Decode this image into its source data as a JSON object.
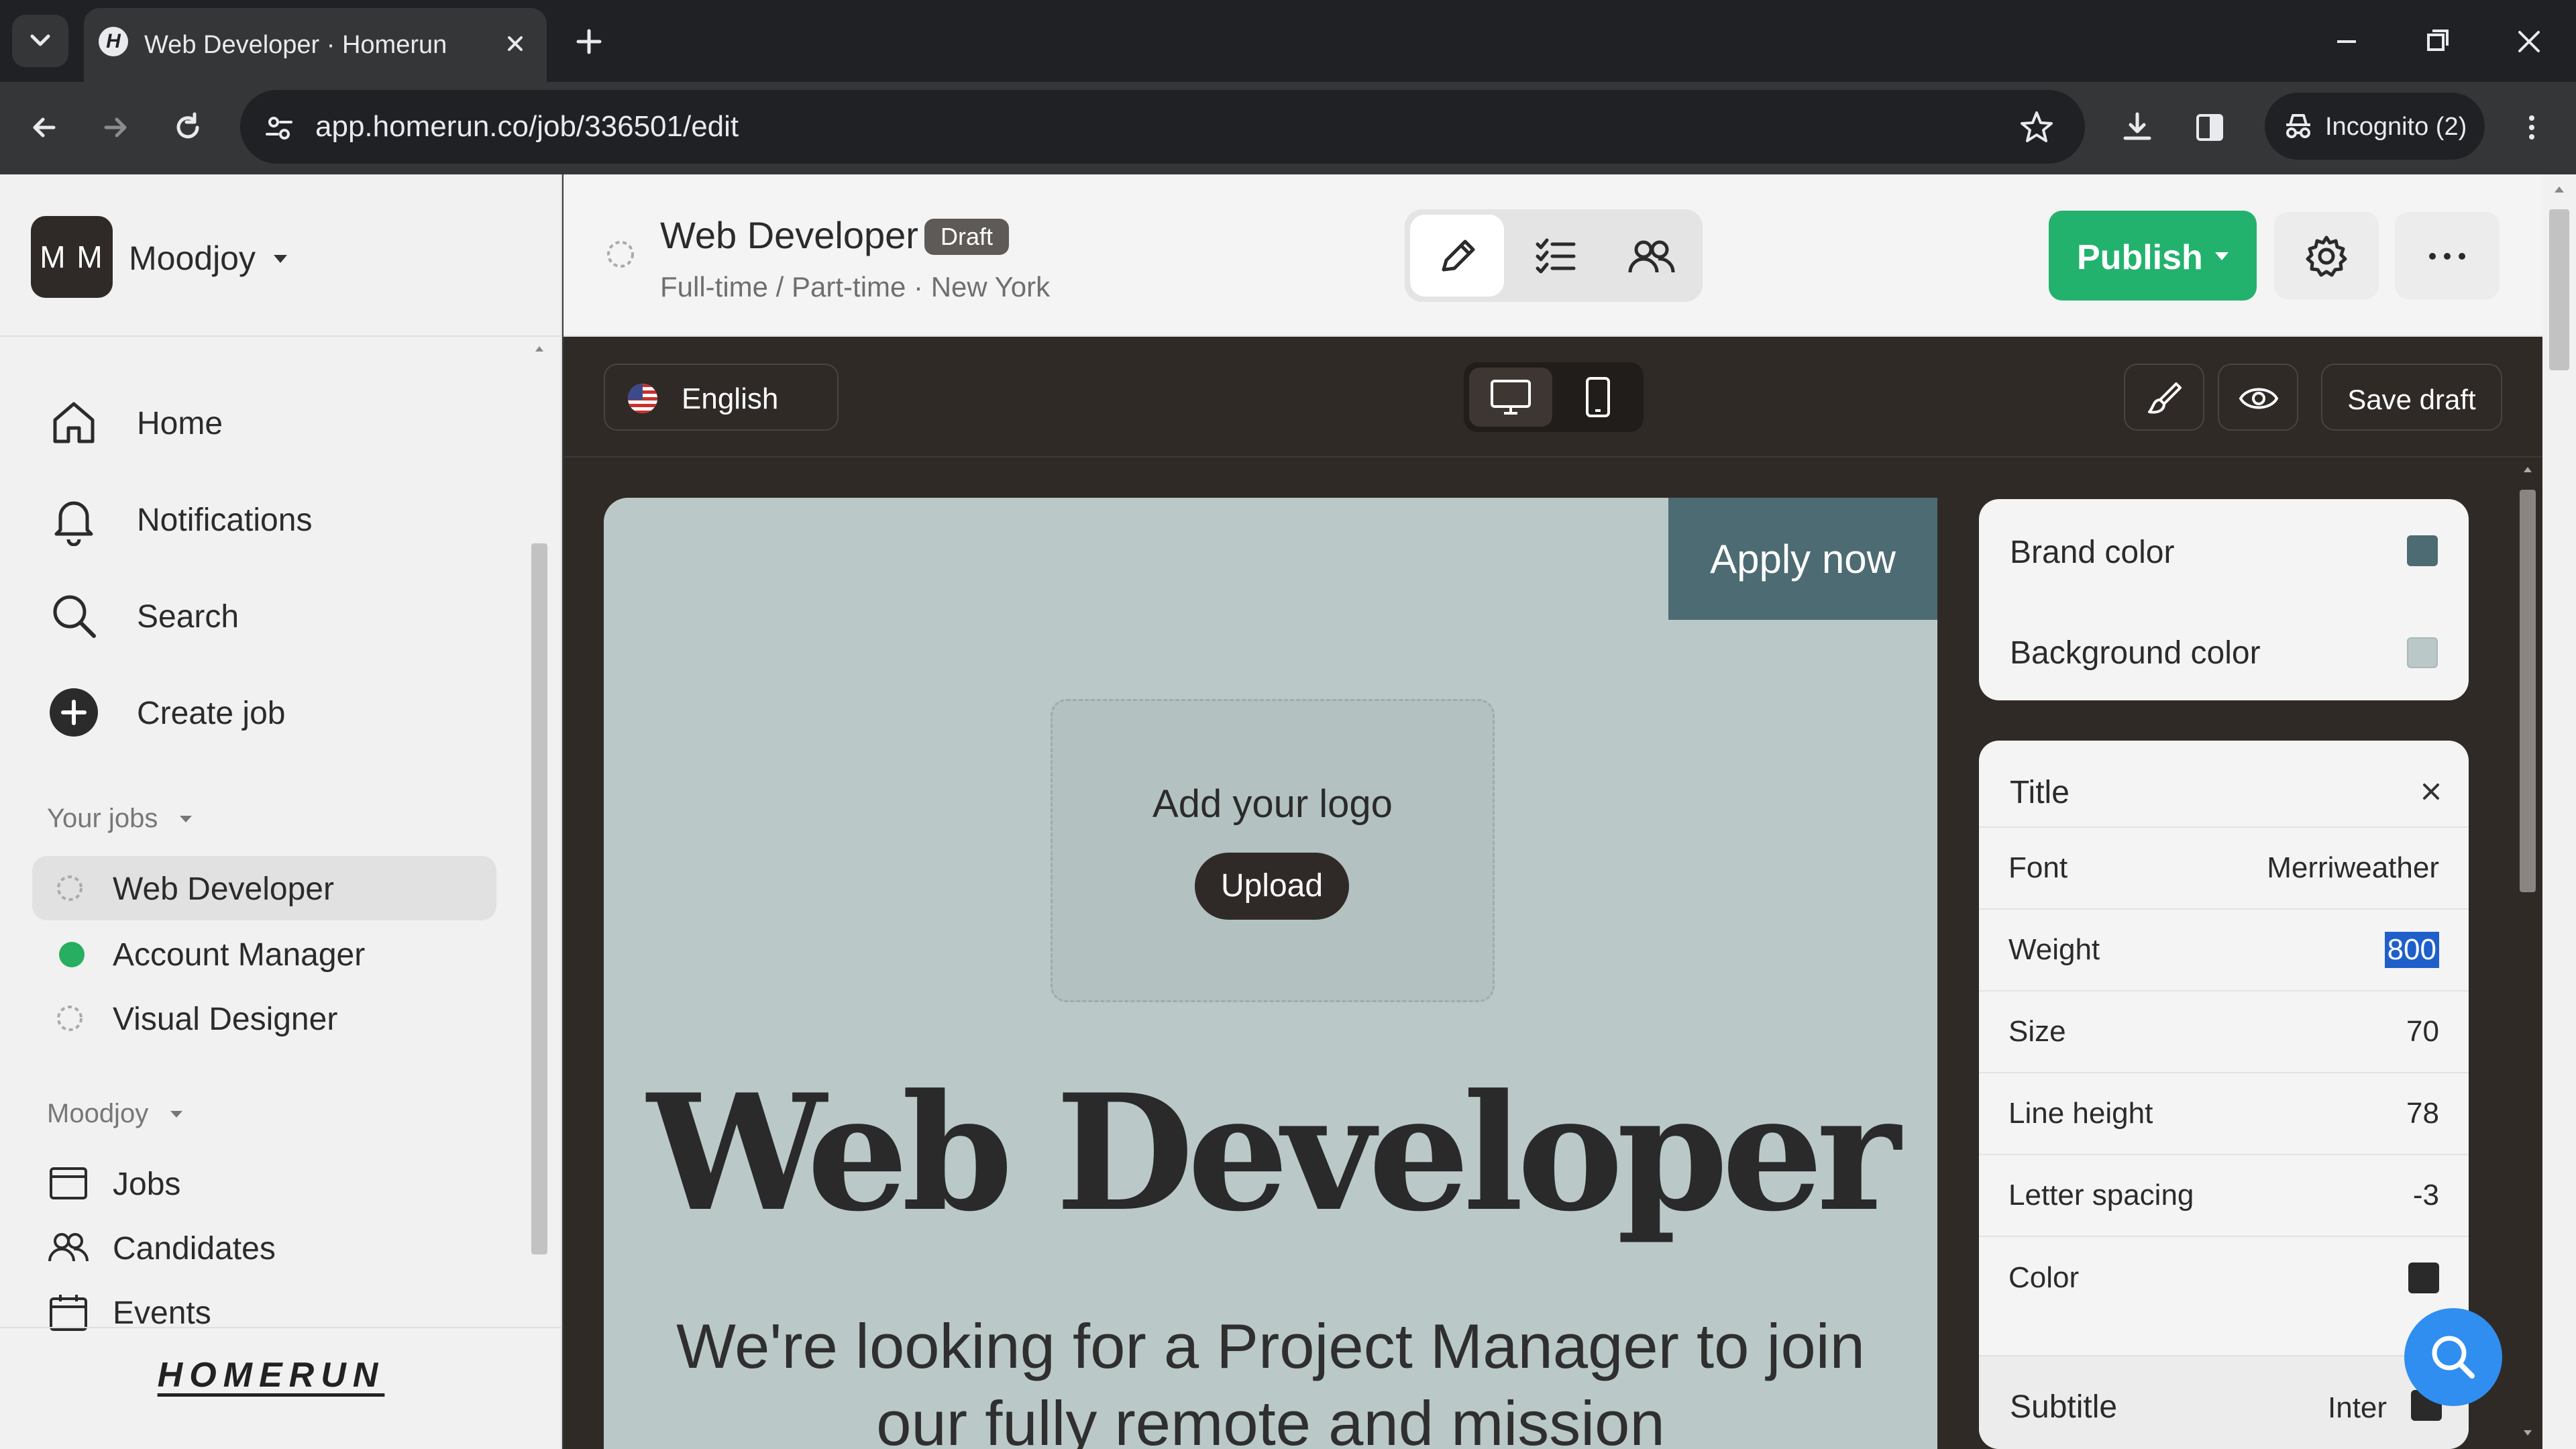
{
  "browser": {
    "tab_title": "Web Developer · Homerun",
    "url": "app.homerun.co/job/336501/edit",
    "incognito_label": "Incognito (2)"
  },
  "sidebar": {
    "avatar_initials": "M M",
    "workspace": "Moodjoy",
    "nav": [
      {
        "label": "Home",
        "icon": "home-icon"
      },
      {
        "label": "Notifications",
        "icon": "bell-icon"
      },
      {
        "label": "Search",
        "icon": "search-icon"
      },
      {
        "label": "Create job",
        "icon": "plus-circle-icon"
      }
    ],
    "your_jobs_label": "Your jobs",
    "jobs": [
      {
        "label": "Web Developer",
        "status": "draft"
      },
      {
        "label": "Account Manager",
        "status": "published",
        "status_color": "#27ae60"
      },
      {
        "label": "Visual Designer",
        "status": "draft"
      }
    ],
    "company_label": "Moodjoy",
    "company_links": [
      {
        "label": "Jobs",
        "icon": "jobs-icon"
      },
      {
        "label": "Candidates",
        "icon": "users-icon"
      },
      {
        "label": "Events",
        "icon": "calendar-icon"
      }
    ],
    "brand": "HOMERUN"
  },
  "topbar": {
    "job_title": "Web Developer",
    "status_badge": "Draft",
    "job_meta": "Full-time / Part-time · New York",
    "publish_label": "Publish",
    "publish_color": "#23b26d"
  },
  "editor": {
    "language": "English",
    "save_draft": "Save draft"
  },
  "preview": {
    "apply_now": "Apply now",
    "add_logo": "Add your logo",
    "upload": "Upload",
    "title": "Web Developer",
    "body": "We're looking for a Project Manager to join our fully remote and mission"
  },
  "style_panel": {
    "brand_color_label": "Brand color",
    "brand_color": "#4d6b72",
    "background_color_label": "Background color",
    "background_color": "#bac9c8",
    "title_section": "Title",
    "properties": [
      {
        "label": "Font",
        "value": "Merriweather"
      },
      {
        "label": "Weight",
        "value": "800"
      },
      {
        "label": "Size",
        "value": "70"
      },
      {
        "label": "Line height",
        "value": "78"
      },
      {
        "label": "Letter spacing",
        "value": "-3"
      },
      {
        "label": "Color",
        "value": ""
      }
    ],
    "title_color": "#2a2a2a",
    "subtitle_section": "Subtitle",
    "subtitle_font": "Inter"
  }
}
